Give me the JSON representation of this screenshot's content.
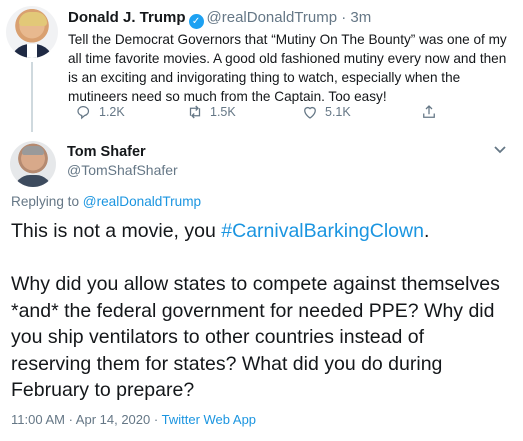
{
  "original_tweet": {
    "display_name": "Donald J. Trump",
    "verified_glyph": "✓",
    "handle": "@realDonaldTrump",
    "separator": "·",
    "time": "3m",
    "text": "Tell the Democrat Governors that “Mutiny On The Bounty” was one of my all time favorite movies. A good old fashioned mutiny every now and then is an exciting and invigorating thing to watch, especially when the mutineers need so much from the Captain. Too easy!",
    "actions": {
      "reply_count": "1.2K",
      "retweet_count": "1.5K",
      "like_count": "5.1K",
      "share_icon": "share-icon"
    }
  },
  "reply": {
    "display_name": "Tom Shafer",
    "handle": "@TomShafShafer",
    "replying_prefix": "Replying to",
    "replying_to": "@realDonaldTrump",
    "text_line1_prefix": "This is not a movie, you ",
    "hashtag": "#CarnivalBarkingClown",
    "text_line1_suffix": ".",
    "text_paragraph2": "Why did you allow states to compete against themselves *and* the federal government for needed PPE? Why did you ship ventilators to other countries instead of reserving them for states? What did you do during February to prepare?",
    "timestamp": "11:00 AM · Apr 14, 2020",
    "meta_separator": "·",
    "source": "Twitter Web App"
  },
  "colors": {
    "accent": "#1da1f2",
    "link": "#1b95e0",
    "muted": "#657786",
    "text": "#14171a"
  },
  "icons": [
    "reply-icon",
    "retweet-icon",
    "like-icon",
    "share-icon",
    "chevron-down-icon",
    "verified-badge-icon"
  ]
}
